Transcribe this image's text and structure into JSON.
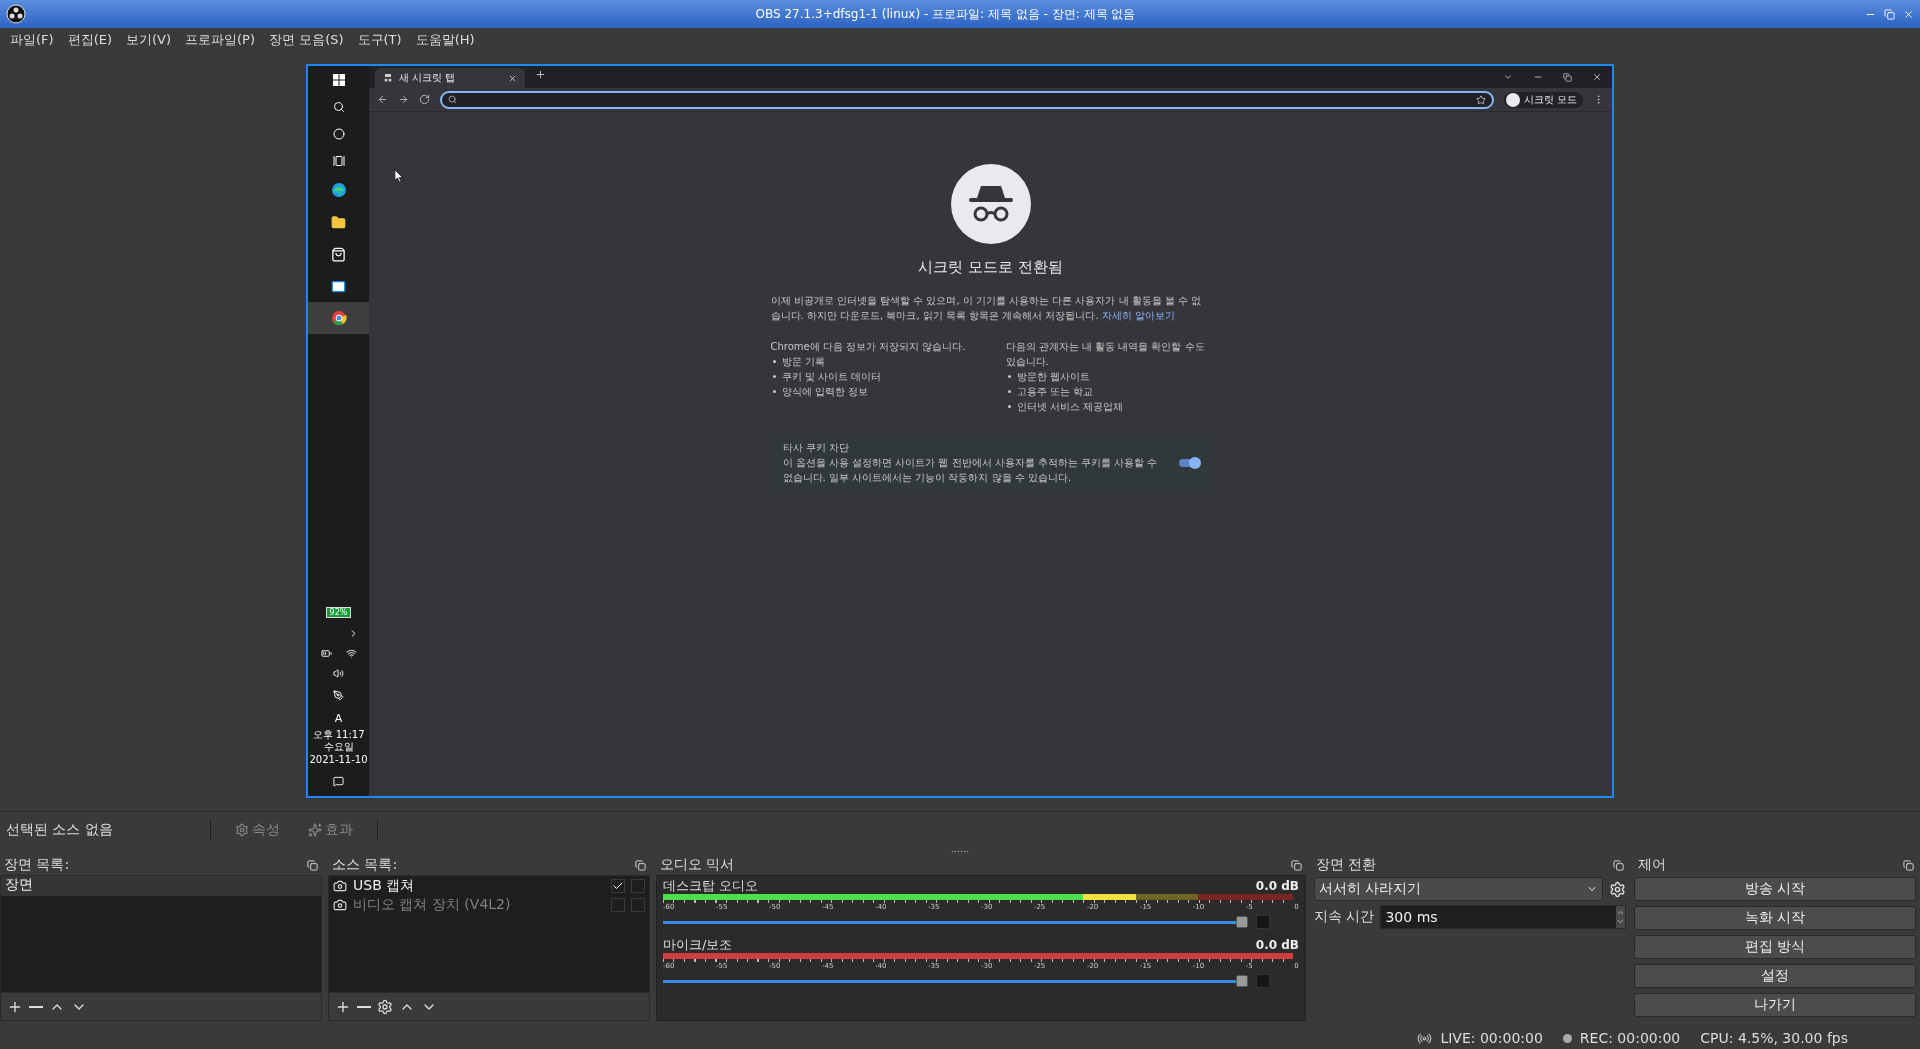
{
  "window": {
    "title": "OBS 27.1.3+dfsg1-1 (linux) - 프로파일: 제목 없음 - 장면: 제목 없음"
  },
  "menu": [
    "파일(F)",
    "편집(E)",
    "보기(V)",
    "프로파일(P)",
    "장면 모음(S)",
    "도구(T)",
    "도움말(H)"
  ],
  "preview": {
    "taskbar": {
      "apps": [
        {
          "kind": "edge",
          "selected": false
        },
        {
          "kind": "explorer",
          "selected": false
        },
        {
          "kind": "store",
          "selected": false
        },
        {
          "kind": "mail",
          "selected": false
        },
        {
          "kind": "chrome",
          "selected": true
        }
      ],
      "battery": "92%",
      "input_mode": "A",
      "clock": [
        "오후 11:17",
        "수요일",
        "2021-11-10"
      ]
    },
    "browser": {
      "tab": "새 시크릿 탭",
      "profile": "시크릿 모드",
      "heading": "시크릿 모드로 전환됨",
      "intro": "이제 비공개로 인터넷을 탐색할 수 있으며, 이 기기를 사용하는 다른 사용자가 내 활동을 볼 수 없습니다. 하지만 다운로드, 북마크, 읽기 목록 항목은 계속해서 저장됩니다.",
      "intro_link": "자세히 알아보기",
      "columns": [
        {
          "title": "Chrome에 다음 정보가 저장되지 않습니다.",
          "items": [
            "방문 기록",
            "쿠키 및 사이트 데이터",
            "양식에 입력한 정보"
          ]
        },
        {
          "title": "다음의 관계자는 내 활동 내역을 확인할 수도 있습니다.",
          "items": [
            "방문한 웹사이트",
            "고용주 또는 학교",
            "인터넷 서비스 제공업체"
          ]
        }
      ],
      "cookie": {
        "title": "타사 쿠키 차단",
        "text": "이 옵션을 사용 설정하면 사이트가 웹 전반에서 사용자를 추적하는 쿠키를 사용할 수 없습니다. 일부 사이트에서는 기능이 작동하지 않을 수 있습니다.",
        "on": true
      }
    }
  },
  "source_toolbar": {
    "status": "선택된 소스 없음",
    "buttons": [
      {
        "kind": "properties",
        "label": "속성",
        "disabled": true
      },
      {
        "kind": "filters",
        "label": "효과",
        "disabled": true
      }
    ]
  },
  "scenes": {
    "title": "장면 목록:",
    "items": [
      {
        "name": "장면",
        "selected": true
      }
    ]
  },
  "sources": {
    "title": "소스 목록:",
    "items": [
      {
        "name": "USB 캡쳐",
        "visible": true,
        "locked": false
      },
      {
        "name": "비디오 캡쳐 장치 (V4L2)",
        "visible": false,
        "locked": false
      }
    ]
  },
  "mixer": {
    "title": "오디오 믹서",
    "channels": [
      {
        "name": "데스크탑 오디오",
        "reading": "0.0 dB",
        "muted": false,
        "checked": false,
        "meter": {
          "level": 0.75
        },
        "volume": {
          "level": 1
        },
        "scale": [
          "-60",
          "-55",
          "-50",
          "-45",
          "-40",
          "-35",
          "-30",
          "-25",
          "-20",
          "-15",
          "-10",
          "-5",
          "0"
        ]
      },
      {
        "name": "마이크/보조",
        "reading": "0.0 dB",
        "muted": true,
        "checked": false,
        "volume": {
          "level": 1
        },
        "scale": [
          "-60",
          "-55",
          "-50",
          "-45",
          "-40",
          "-35",
          "-30",
          "-25",
          "-20",
          "-15",
          "-10",
          "-5",
          "0"
        ]
      }
    ]
  },
  "transitions": {
    "title": "장면 전환",
    "selected": "서서히 사라지기",
    "duration_label": "지속 시간",
    "duration": "300 ms"
  },
  "controls": {
    "title": "제어",
    "buttons": [
      "방송 시작",
      "녹화 시작",
      "편집 방식",
      "설정",
      "나가기"
    ]
  },
  "status_bar": {
    "live": "LIVE: 00:00:00",
    "rec": "REC: 00:00:00",
    "cpu": "CPU: 4.5%, 30.00 fps"
  }
}
